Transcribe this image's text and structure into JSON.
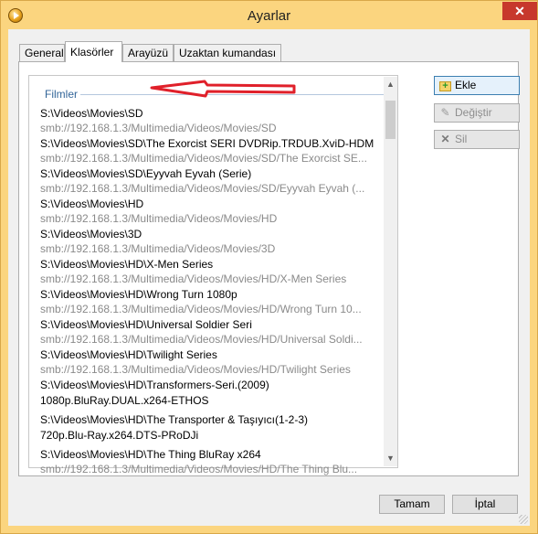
{
  "window": {
    "title": "Ayarlar",
    "close_glyph": "✕"
  },
  "tabs": [
    {
      "label": "General",
      "active": false
    },
    {
      "label": "Klasörler",
      "active": true
    },
    {
      "label": "Arayüzü",
      "active": false
    },
    {
      "label": "Uzaktan kumandası",
      "active": false
    }
  ],
  "folders": {
    "group_label": "Filmler",
    "items": [
      {
        "path": "S:\\Videos\\Movies\\SD",
        "url": "smb://192.168.1.3/Multimedia/Videos/Movies/SD"
      },
      {
        "path": "S:\\Videos\\Movies\\SD\\The Exorcist SERI DVDRip.TRDUB.XviD-HDM",
        "url": "smb://192.168.1.3/Multimedia/Videos/Movies/SD/The Exorcist SE..."
      },
      {
        "path": "S:\\Videos\\Movies\\SD\\Eyyvah Eyvah (Serie)",
        "url": "smb://192.168.1.3/Multimedia/Videos/Movies/SD/Eyyvah Eyvah (..."
      },
      {
        "path": "S:\\Videos\\Movies\\HD",
        "url": "smb://192.168.1.3/Multimedia/Videos/Movies/HD"
      },
      {
        "path": "S:\\Videos\\Movies\\3D",
        "url": "smb://192.168.1.3/Multimedia/Videos/Movies/3D"
      },
      {
        "path": "S:\\Videos\\Movies\\HD\\X-Men  Series",
        "url": "smb://192.168.1.3/Multimedia/Videos/Movies/HD/X-Men  Series"
      },
      {
        "path": "S:\\Videos\\Movies\\HD\\Wrong Turn 1080p",
        "url": "smb://192.168.1.3/Multimedia/Videos/Movies/HD/Wrong Turn 10..."
      },
      {
        "path": "S:\\Videos\\Movies\\HD\\Universal Soldier Seri",
        "url": "smb://192.168.1.3/Multimedia/Videos/Movies/HD/Universal Soldi..."
      },
      {
        "path": "S:\\Videos\\Movies\\HD\\Twilight Series",
        "url": "smb://192.168.1.3/Multimedia/Videos/Movies/HD/Twilight Series"
      },
      {
        "path": "S:\\Videos\\Movies\\HD\\Transformers-Seri.(2009)",
        "path2": "1080p.BluRay.DUAL.x264-ETHOS"
      },
      {
        "path": "S:\\Videos\\Movies\\HD\\The Transporter & Taşıyıcı(1-2-3)",
        "path2": "720p.Blu-Ray.x264.DTS-PRoDJi"
      },
      {
        "path": "S:\\Videos\\Movies\\HD\\The Thing BluRay x264",
        "url": "smb://192.168.1.3/Multimedia/Videos/Movies/HD/The Thing Blu..."
      }
    ]
  },
  "buttons": {
    "add": "Ekle",
    "edit": "Değiştir",
    "remove": "Sil",
    "ok": "Tamam",
    "cancel": "İptal"
  },
  "colors": {
    "titlebar": "#fbd57f",
    "close": "#c7382c",
    "group_label": "#336699",
    "arrow": "#e0202a"
  }
}
